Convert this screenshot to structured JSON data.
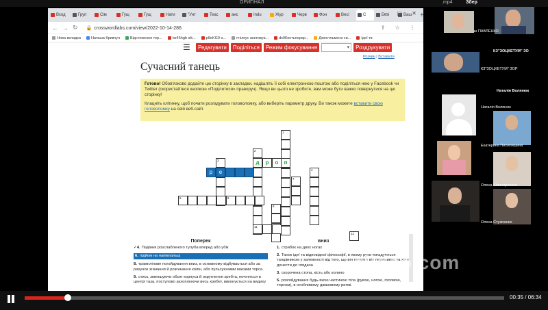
{
  "window": {
    "title": "ОРИГІНАЛ",
    "file_ext": ".mp4",
    "save_label": "Збер"
  },
  "tabs": [
    {
      "label": "Вход",
      "color": "#d93025"
    },
    {
      "label": "Груп",
      "color": "#555"
    },
    {
      "label": "Сім",
      "color": "#d93025"
    },
    {
      "label": "Гущ",
      "color": "#d93025"
    },
    {
      "label": "Гущ",
      "color": "#d93025"
    },
    {
      "label": "Нати",
      "color": "#d93025"
    },
    {
      "label": "\"Унт",
      "color": "#555"
    },
    {
      "label": "Teac",
      "color": "#d93025"
    },
    {
      "label": "анс",
      "color": "#d93025"
    },
    {
      "label": "Indu",
      "color": "#d93025"
    },
    {
      "label": "Жур",
      "color": "#f9ab00"
    },
    {
      "label": "Черв",
      "color": "#d93025"
    },
    {
      "label": "Фон",
      "color": "#d93025"
    },
    {
      "label": "Весі",
      "color": "#d93025"
    },
    {
      "label": "С",
      "color": "#555",
      "active": true
    },
    {
      "label": "Безі",
      "color": "#555"
    },
    {
      "label": "Ваш",
      "color": "#555"
    }
  ],
  "address": {
    "url": "crosswordlabs.com/view/2022-10-14-286"
  },
  "bookmarks": [
    {
      "label": "Нова вкладка",
      "color": "#999"
    },
    {
      "label": "Наташа Кривчун",
      "color": "#4285f4"
    },
    {
      "label": "Відстеження тер...",
      "color": "#34a853"
    },
    {
      "label": "bz45hgb sik...",
      "color": "#d93025"
    },
    {
      "label": "p8eKG0-s...",
      "color": "#d93025"
    },
    {
      "label": "пчілкус анктивуа...",
      "color": "#999"
    },
    {
      "label": "ds9Контьпорар...",
      "color": "#d93025"
    },
    {
      "label": "Джентльмени си...",
      "color": "#f9ab00"
    },
    {
      "label": "Ідеї тв",
      "color": "#d93025"
    }
  ],
  "toolbar": {
    "edit": "Редагувати",
    "share": "Поділіться",
    "focus": "Режим фокусування",
    "print": "Роздрукувати"
  },
  "links": {
    "solution": "Розчин",
    "insert": "Вставити"
  },
  "page_title": "Сучасний танець",
  "notice": {
    "lead": "Готово!",
    "p1": "Обов'язково додайте цю сторінку в закладки, надішліть її собі електронною поштою або поділіться нею у Facebook чи Twitter (скористайтеся кнопкою «Поділитися» праворуч). Якщо ви цього не зробите, вам може бути важко повернутися на цю сторінку!",
    "p2_before": "Клацніть клітинку, щоб почати розгадувати головоломку, або виберіть параметр друку. Ви також можете ",
    "p2_link": "вставити свою головоломку",
    "p2_after": " на свій веб-сайт."
  },
  "crossword": {
    "letters": {
      "r": "р",
      "e": "е",
      "d": "д",
      "r2": "р",
      "o": "о",
      "p": "п"
    },
    "numbers": [
      "1",
      "2",
      "3",
      "4",
      "5",
      "6",
      "7",
      "8",
      "9",
      "10",
      "11",
      "12"
    ]
  },
  "clues": {
    "across_title": "Поперек",
    "down_title": "вниз",
    "across": [
      {
        "num": "4.",
        "text": "Падіння розслабленого тулуба вперед або убік",
        "check": true
      },
      {
        "num": "6.",
        "text": "підйом на напівпальці",
        "selected": true
      },
      {
        "num": "8.",
        "text": "трамплінове погойдування вниз, в основному відбувається або за рахунок згинання й розгинання колін, або пульсуючими махами торса."
      },
      {
        "num": "9.",
        "text": "стиск, зменшуючи обсяг корпуса й округлення хребта, почнеться в центрі таза, поступово захоплюючи весь хребет, виконується на видиху"
      }
    ],
    "down": [
      {
        "num": "1.",
        "text": "стрибок на двох ногах"
      },
      {
        "num": "2.",
        "text": "Танок ідеї та відповідної філософії, в якому рухи вигадуються танцівником у залежності від того, що він почуття він переживає та хоче донести до глядача"
      },
      {
        "num": "3.",
        "text": "скорочена стопа, кість або колино"
      },
      {
        "num": "5.",
        "text": "розгойдування будь-якою частиною тіла (рукою, ногою, головою, торсом), в особливому джазовому ритмі."
      }
    ]
  },
  "participants": [
    {
      "name": "Руслан ПАВЛЕНКО"
    },
    {
      "name": "КЗ\"ЗОЦХЕТУМ\" ЗО"
    },
    {
      "name": "КЗ\"ЗОЦХЕТУМ\" ЗОР"
    },
    {
      "name": "Наталія Волянюк"
    },
    {
      "name": "Наталія Волянюк"
    },
    {
      "name": "Екатерина Пилипишина"
    },
    {
      "name": "Олена Шпилярченко"
    },
    {
      "name": "Олена Стужченко"
    }
  ],
  "watermark": "clideo.com",
  "player": {
    "time": "00:35 / 06:34",
    "progress": 0.0893
  }
}
